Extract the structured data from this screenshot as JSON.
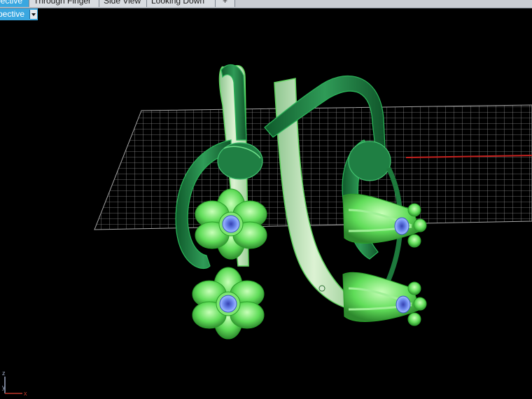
{
  "tabs": [
    {
      "label": "pective",
      "active": true
    },
    {
      "label": "Through Finger",
      "active": false
    },
    {
      "label": "Side View",
      "active": false
    },
    {
      "label": "Looking Down",
      "active": false
    },
    {
      "label": "+",
      "active": false
    }
  ],
  "viewport": {
    "menu_label": "spective",
    "axes": {
      "z_label": "z",
      "y_label": "y",
      "x_label": "x"
    }
  },
  "colors": {
    "accent": "#3aa7e0",
    "background": "#000000",
    "grid": "#9a9a9a",
    "metal_dark": "#1a7a3e",
    "metal_pale": "#b8dfb0",
    "flower": "#59e056",
    "gem": "#6b86e8"
  }
}
